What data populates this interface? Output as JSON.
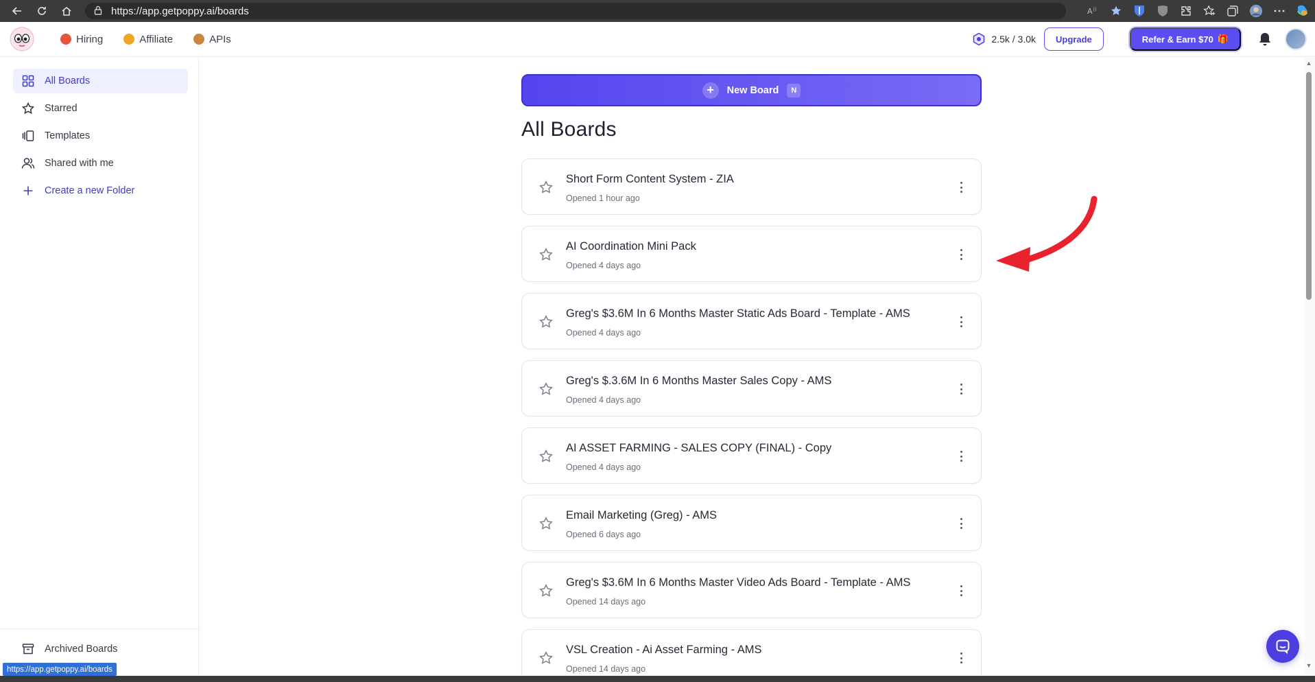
{
  "browser": {
    "url": "https://app.getpoppy.ai/boards",
    "status_url": "https://app.getpoppy.ai/boards"
  },
  "header": {
    "nav": [
      {
        "label": "Hiring",
        "emoji_color": "#e8553a"
      },
      {
        "label": "Affiliate",
        "emoji_color": "#f1a623"
      },
      {
        "label": "APIs",
        "emoji_color": "#c9873f"
      }
    ],
    "credits": "2.5k / 3.0k",
    "upgrade_label": "Upgrade",
    "refer_label": "Refer & Earn $70",
    "refer_emoji": "🎁"
  },
  "sidebar": {
    "items": [
      {
        "label": "All Boards",
        "icon": "grid-icon"
      },
      {
        "label": "Starred",
        "icon": "star-icon"
      },
      {
        "label": "Templates",
        "icon": "templates-icon"
      },
      {
        "label": "Shared with me",
        "icon": "users-icon"
      },
      {
        "label": "Create a new Folder",
        "icon": "plus-icon"
      }
    ],
    "archived_label": "Archived Boards"
  },
  "main": {
    "new_board_label": "New Board",
    "new_board_shortcut": "N",
    "title": "All Boards",
    "boards": [
      {
        "title": "Short Form Content System - ZIA",
        "opened": "Opened 1 hour ago"
      },
      {
        "title": "AI Coordination Mini Pack",
        "opened": "Opened 4 days ago"
      },
      {
        "title": "Greg's $3.6M In 6 Months Master Static Ads Board - Template - AMS",
        "opened": "Opened 4 days ago"
      },
      {
        "title": "Greg's $.3.6M In 6 Months Master Sales Copy - AMS",
        "opened": "Opened 4 days ago"
      },
      {
        "title": "AI ASSET FARMING - SALES COPY (FINAL) - Copy",
        "opened": "Opened 4 days ago"
      },
      {
        "title": "Email Marketing (Greg) - AMS",
        "opened": "Opened 6 days ago"
      },
      {
        "title": "Greg's $3.6M In 6 Months Master Video Ads Board - Template - AMS",
        "opened": "Opened 14 days ago"
      },
      {
        "title": "VSL Creation - Ai Asset Farming - AMS",
        "opened": "Opened 14 days ago"
      }
    ]
  },
  "colors": {
    "accent": "#5a4df1",
    "arrow": "#e8232d"
  }
}
